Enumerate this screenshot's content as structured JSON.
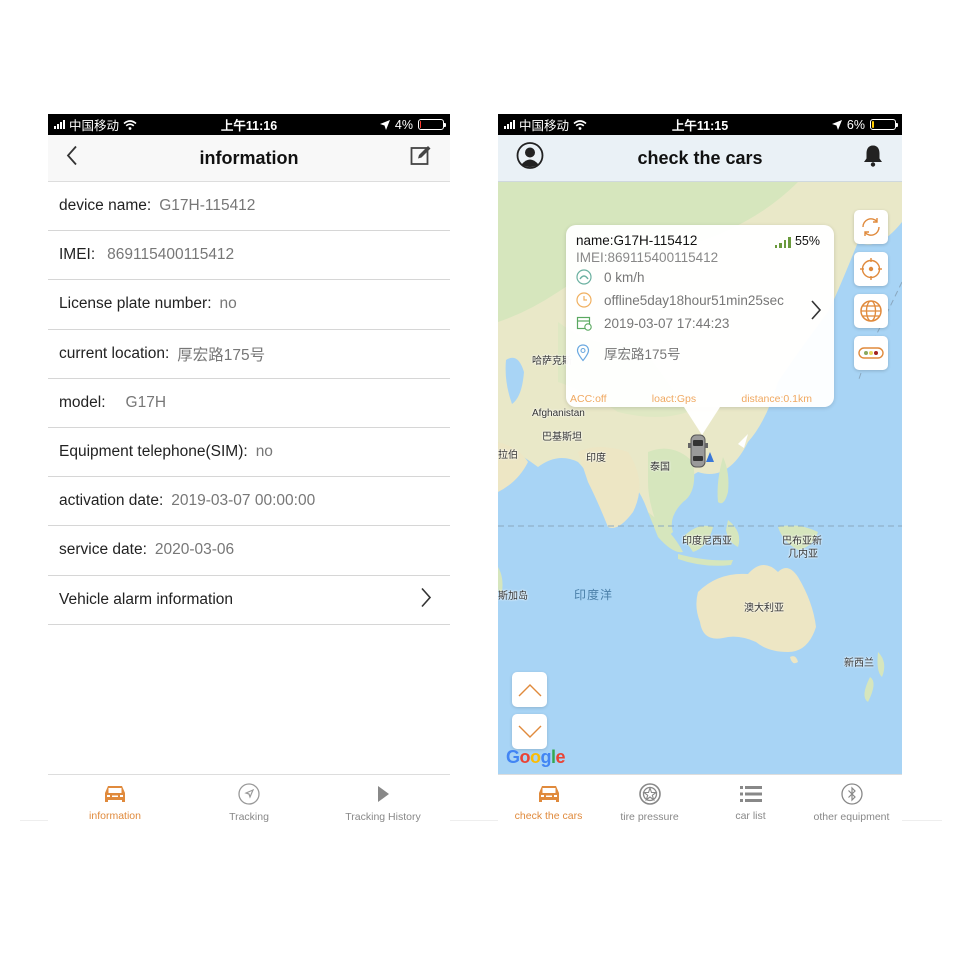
{
  "left_screen": {
    "status_bar": {
      "carrier": "中国移动",
      "time": "上午11:16",
      "battery_percent": "4%",
      "battery_level": 0.04
    },
    "nav": {
      "title": "information",
      "back_icon": "chevron-left-icon",
      "edit_icon": "edit-icon"
    },
    "fields": [
      {
        "label": "device name:",
        "value": "G17H-115412"
      },
      {
        "label": "IMEI:",
        "value": "869115400115412"
      },
      {
        "label": "License plate number:",
        "value": "no"
      },
      {
        "label": "current location:",
        "value": "厚宏路175号"
      },
      {
        "label": "model:",
        "value": "G17H"
      },
      {
        "label": "Equipment telephone(SIM):",
        "value": "no"
      },
      {
        "label": "activation date:",
        "value": "2019-03-07 00:00:00"
      },
      {
        "label": "service date:",
        "value": "2020-03-06"
      }
    ],
    "alarm_row": {
      "label": "Vehicle alarm information"
    },
    "tabs": [
      {
        "label": "information",
        "icon": "car-icon",
        "active": true
      },
      {
        "label": "Tracking",
        "icon": "navigation-arrow-icon",
        "active": false
      },
      {
        "label": "Tracking History",
        "icon": "play-icon",
        "active": false
      }
    ]
  },
  "right_screen": {
    "status_bar": {
      "carrier": "中国移动",
      "time": "上午11:15",
      "battery_percent": "6%",
      "battery_level": 0.06
    },
    "nav": {
      "title": "check the cars",
      "profile_icon": "user-avatar-icon",
      "bell_icon": "bell-icon"
    },
    "popup": {
      "name": "name:G17H-115412",
      "battery": "55%",
      "imei": "IMEI:869115400115412",
      "speed": "0 km/h",
      "status": "offline5day18hour51min25sec",
      "datetime": "2019-03-07 17:44:23",
      "address": "厚宏路175号",
      "acc": "ACC:off",
      "locate": "loact:Gps",
      "distance": "distance:0.1km"
    },
    "map_labels": [
      {
        "text": "哈萨克斯",
        "kind": "country"
      },
      {
        "text": "Afghanistan",
        "kind": "country"
      },
      {
        "text": "巴基斯坦",
        "kind": "country"
      },
      {
        "text": "拉伯",
        "kind": "country"
      },
      {
        "text": "印度",
        "kind": "country"
      },
      {
        "text": "泰国",
        "kind": "country"
      },
      {
        "text": "印度尼西亚",
        "kind": "country"
      },
      {
        "text": "巴布亚新",
        "kind": "country"
      },
      {
        "text": "几内亚",
        "kind": "country"
      },
      {
        "text": "斯加岛",
        "kind": "country"
      },
      {
        "text": "印度洋",
        "kind": "ocean"
      },
      {
        "text": "澳大利亚",
        "kind": "country"
      },
      {
        "text": "新西兰",
        "kind": "country"
      }
    ],
    "map_controls": [
      {
        "name": "refresh",
        "icon": "refresh-icon"
      },
      {
        "name": "locate",
        "icon": "crosshair-icon"
      },
      {
        "name": "map-type",
        "icon": "globe-icon"
      },
      {
        "name": "traffic",
        "icon": "traffic-light-icon"
      }
    ],
    "zoom_in_icon": "chevron-up-icon",
    "zoom_out_icon": "chevron-down-icon",
    "google_logo": [
      "G",
      "o",
      "o",
      "g",
      "l",
      "e"
    ],
    "tabs": [
      {
        "label": "check the cars",
        "icon": "car-icon",
        "active": true
      },
      {
        "label": "tire pressure",
        "icon": "tire-icon",
        "active": false
      },
      {
        "label": "car list",
        "icon": "list-icon",
        "active": false
      },
      {
        "label": "other equipment",
        "icon": "bluetooth-icon",
        "active": false
      }
    ]
  },
  "colors": {
    "accent": "#e08a3c",
    "ocean": "#a8d4f5",
    "land": "#f1ead0"
  }
}
